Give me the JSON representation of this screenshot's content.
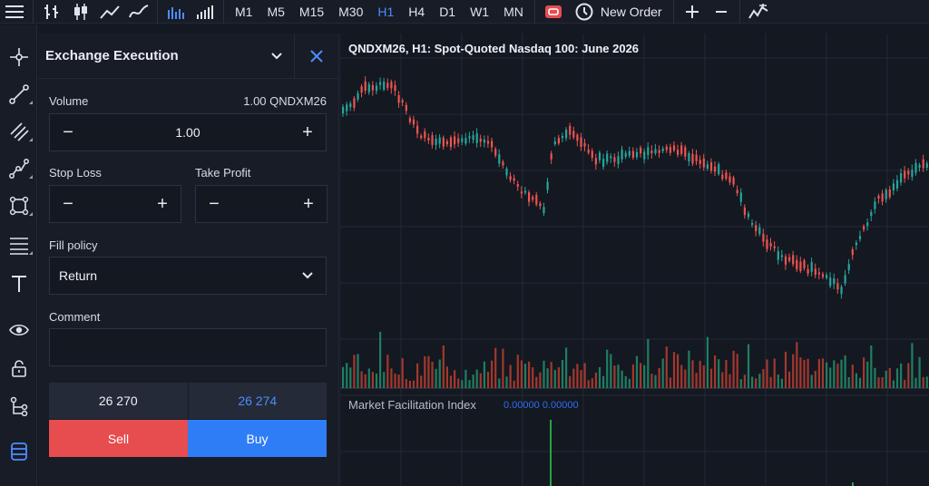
{
  "toolbar": {
    "timeframes": [
      "M1",
      "M5",
      "M15",
      "M30",
      "H1",
      "H4",
      "D1",
      "W1",
      "MN"
    ],
    "active_timeframe": "H1",
    "new_order_label": "New Order",
    "icons": [
      "menu-icon",
      "bar-chart-icon",
      "candlestick-icon",
      "line-chart-icon",
      "area-chart-icon",
      "volume-icon",
      "tick-volume-icon",
      "one-click-trading-icon",
      "new-order-icon",
      "zoom-in-icon",
      "zoom-out-icon",
      "indicators-icon"
    ]
  },
  "left_tools": [
    "crosshair-icon",
    "trendline-icon",
    "channel-icon",
    "fibonacci-icon",
    "shapes-icon",
    "levels-icon",
    "text-icon",
    "eye-icon",
    "lock-icon",
    "tree-icon",
    "layers-icon"
  ],
  "panel": {
    "title": "Exchange Execution",
    "volume_label": "Volume",
    "volume_info": "1.00 QNDXM26",
    "volume_value": "1.00",
    "stop_loss_label": "Stop Loss",
    "take_profit_label": "Take Profit",
    "fill_policy_label": "Fill policy",
    "fill_policy_value": "Return",
    "comment_label": "Comment",
    "comment_value": "",
    "bid": "26 270",
    "ask": "26 274",
    "sell_label": "Sell",
    "buy_label": "Buy"
  },
  "chart": {
    "title": "QNDXM26, H1: Spot-Quoted Nasdaq 100: June 2026",
    "indicator_title": "Market Facilitation Index",
    "indicator_value": "0.00000 0.00000",
    "colors": {
      "up": "#26a69a",
      "down": "#ef5350",
      "grid": "#232836",
      "mfi_up": "#2dd34a",
      "mfi_label": "#2f6df0"
    }
  },
  "colors": {
    "accent": "#4c8dff",
    "sell": "#e74c4f",
    "buy": "#2f7df6"
  }
}
